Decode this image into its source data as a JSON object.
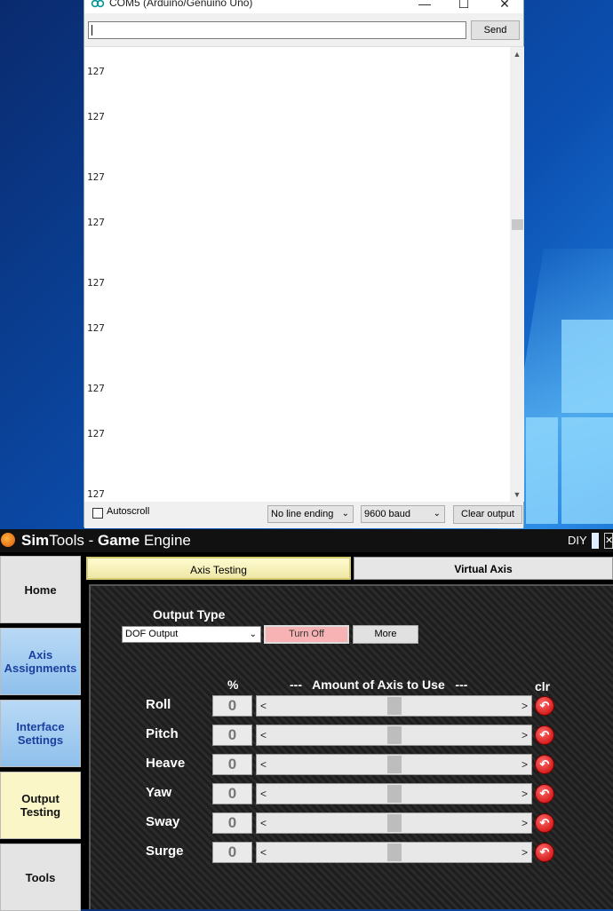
{
  "serial_monitor": {
    "title": "COM5 (Arduino/Genuino Uno)",
    "window_buttons": {
      "minimize": "—",
      "maximize": "☐",
      "close": "✕"
    },
    "input_value": "",
    "send_label": "Send",
    "output_lines": [
      "127",
      "127",
      "127",
      "127",
      "127",
      "127",
      "127",
      "127",
      "127"
    ],
    "autoscroll_label": "Autoscroll",
    "autoscroll_checked": false,
    "line_ending": "No line ending",
    "baud": "9600 baud",
    "clear_label": "Clear output"
  },
  "simtools": {
    "title_sim": "Sim",
    "title_tools": "Tools - ",
    "title_game": "Game",
    "title_engine": " Engine",
    "diy_label": "DIY",
    "sidebar": [
      {
        "label": "Home",
        "style": "grey"
      },
      {
        "label": "Axis Assignments",
        "style": "blue"
      },
      {
        "label": "Interface Settings",
        "style": "blue"
      },
      {
        "label": "Output Testing",
        "style": "yellow"
      },
      {
        "label": "Tools",
        "style": "grey"
      }
    ],
    "tabs": {
      "axis_testing": "Axis Testing",
      "virtual_axis": "Virtual Axis"
    },
    "output_type_label": "Output Type",
    "output_type_value": "DOF Output",
    "turn_off_label": "Turn Off",
    "more_label": "More",
    "pct_header": "%",
    "amount_header": "---   Amount of Axis to Use   ---",
    "clr_header": "clr",
    "axes": [
      {
        "name": "Roll",
        "value": "0"
      },
      {
        "name": "Pitch",
        "value": "0"
      },
      {
        "name": "Heave",
        "value": "0"
      },
      {
        "name": "Yaw",
        "value": "0"
      },
      {
        "name": "Sway",
        "value": "0"
      },
      {
        "name": "Surge",
        "value": "0"
      }
    ],
    "slider_left": "<",
    "slider_right": ">",
    "slider_position": 0.5
  },
  "colors": {
    "turn_off_bg": "#f7b3b3",
    "active_tab": "#fffbd0",
    "clr_red": "#c40000"
  }
}
